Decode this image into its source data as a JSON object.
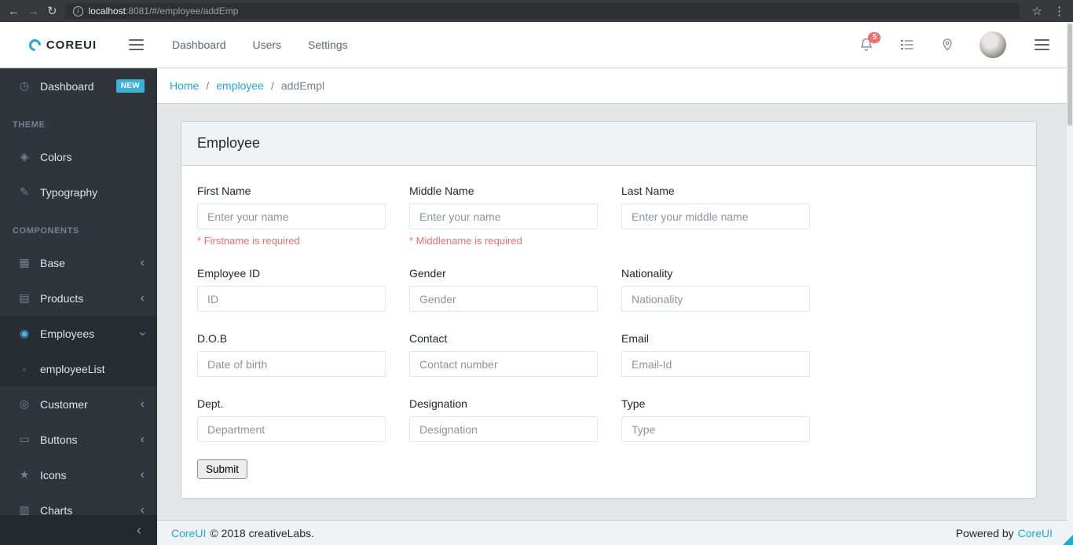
{
  "browser": {
    "back_icon": "←",
    "forward_icon": "→",
    "refresh_icon": "↻",
    "info_label": "i",
    "url_host": "localhost",
    "url_rest": ":8081/#/employee/addEmp",
    "star_icon": "☆",
    "menu_icon": "⋮"
  },
  "brand": {
    "name": "COREUI"
  },
  "header": {
    "nav": [
      {
        "label": "Dashboard"
      },
      {
        "label": "Users"
      },
      {
        "label": "Settings"
      }
    ],
    "notification_count": "5"
  },
  "icons": {
    "speedometer": "◷",
    "drop": "◈",
    "pencil": "✎",
    "puzzle": "▦",
    "basket": "▤",
    "people": "◉",
    "dot": "◦",
    "customer": "◎",
    "cursor": "▭",
    "star": "★",
    "chart": "▥",
    "chevron": "‹",
    "minimizer": "‹"
  },
  "sidebar": {
    "items": [
      {
        "label": "Dashboard",
        "badge": "NEW"
      },
      {
        "label": "THEME"
      },
      {
        "label": "Colors"
      },
      {
        "label": "Typography"
      },
      {
        "label": "COMPONENTS"
      },
      {
        "label": "Base"
      },
      {
        "label": "Products"
      },
      {
        "label": "Employees"
      },
      {
        "label": "employeeList"
      },
      {
        "label": "Customer"
      },
      {
        "label": "Buttons"
      },
      {
        "label": "Icons"
      },
      {
        "label": "Charts"
      }
    ]
  },
  "breadcrumb": {
    "home": "Home",
    "separator": "/",
    "section": "employee",
    "current": "addEmpl"
  },
  "card": {
    "title": "Employee",
    "submit_label": "Submit",
    "fields": [
      {
        "label": "First Name",
        "placeholder": "Enter your name",
        "error": "* Firstname is required"
      },
      {
        "label": "Middle Name",
        "placeholder": "Enter your name",
        "error": "* Middlename is required"
      },
      {
        "label": "Last Name",
        "placeholder": "Enter your middle name"
      },
      {
        "label": "Employee ID",
        "placeholder": "ID"
      },
      {
        "label": "Gender",
        "placeholder": "Gender"
      },
      {
        "label": "Nationality",
        "placeholder": "Nationality"
      },
      {
        "label": "D.O.B",
        "placeholder": "Date of birth"
      },
      {
        "label": "Contact",
        "placeholder": "Contact number"
      },
      {
        "label": "Email",
        "placeholder": "Email-Id"
      },
      {
        "label": "Dept.",
        "placeholder": "Department"
      },
      {
        "label": "Designation",
        "placeholder": "Designation"
      },
      {
        "label": "Type",
        "placeholder": "Type"
      }
    ]
  },
  "footer": {
    "brand_link": "CoreUI",
    "copyright": "© 2018 creativeLabs.",
    "powered_text": "Powered by",
    "powered_link": "CoreUI"
  }
}
